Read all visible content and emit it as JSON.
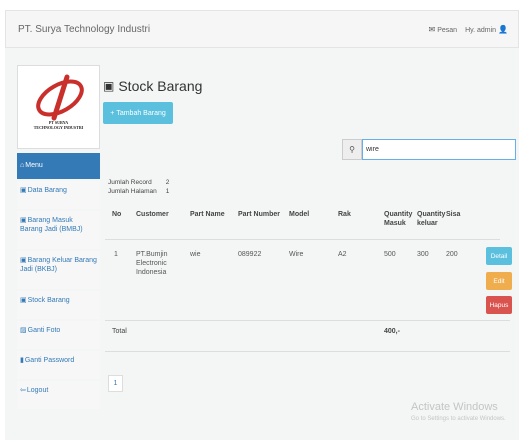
{
  "navbar": {
    "brand": "PT. Surya Technology Industri",
    "message_label": "Pesan",
    "greeting": "Hy. admin"
  },
  "logo": {
    "line1": "PT SURYA",
    "line2": "TECHNOLOGY INDUSTRI"
  },
  "sidebar": {
    "items": [
      {
        "label": "Menu"
      },
      {
        "label": "Data Barang"
      },
      {
        "label": "Barang Masuk Barang Jadi (BMBJ)"
      },
      {
        "label": "Barang Keluar Barang Jadi (BKBJ)"
      },
      {
        "label": "Stock Barang"
      },
      {
        "label": "Ganti Foto"
      },
      {
        "label": "Ganti Password"
      },
      {
        "label": "Logout"
      }
    ]
  },
  "page": {
    "title": "Stock Barang",
    "add_button": "Tambah Barang"
  },
  "search": {
    "value": "wire"
  },
  "records": {
    "total_label": "Jumlah Record",
    "total_value": "2",
    "pages_label": "Jumlah Halaman",
    "pages_value": "1"
  },
  "table": {
    "headers": [
      "No",
      "Customer",
      "Part Name",
      "Part Number",
      "Model",
      "Rak",
      "Quantity Masuk",
      "Quantity keluar",
      "Sisa"
    ],
    "rows": [
      {
        "no": "1",
        "customer": "PT.Bumjin Electronic Indonesia",
        "part_name": "wie",
        "part_number": "089922",
        "model": "Wire",
        "rak": "A2",
        "qty_masuk": "500",
        "qty_keluar": "300",
        "sisa": "200",
        "actions": [
          "Detail",
          "Edit",
          "Hapus"
        ]
      }
    ],
    "total_label": "Total",
    "total_value": "400,-"
  },
  "pagination": {
    "current": "1"
  },
  "watermark": {
    "title": "Activate Windows",
    "subtitle": "Go to Settings to activate Windows."
  },
  "colors": {
    "primary": "#337ab7",
    "info": "#5bc0de",
    "warning": "#f0ad4e",
    "danger": "#d9534f"
  }
}
